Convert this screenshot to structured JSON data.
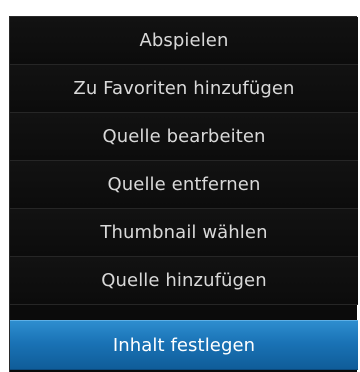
{
  "context_menu": {
    "items": [
      {
        "label": "Abspielen"
      },
      {
        "label": "Zu Favoriten hinzufügen"
      },
      {
        "label": "Quelle bearbeiten"
      },
      {
        "label": "Quelle entfernen"
      },
      {
        "label": "Thumbnail wählen"
      },
      {
        "label": "Quelle hinzufügen"
      },
      {
        "label": "Inhalt festlegen",
        "selected": true
      }
    ],
    "colors": {
      "background": "#0b0b0b",
      "text": "#d9d9d9",
      "selected_background": "#1a73b6",
      "selected_text": "#ffffff"
    }
  }
}
